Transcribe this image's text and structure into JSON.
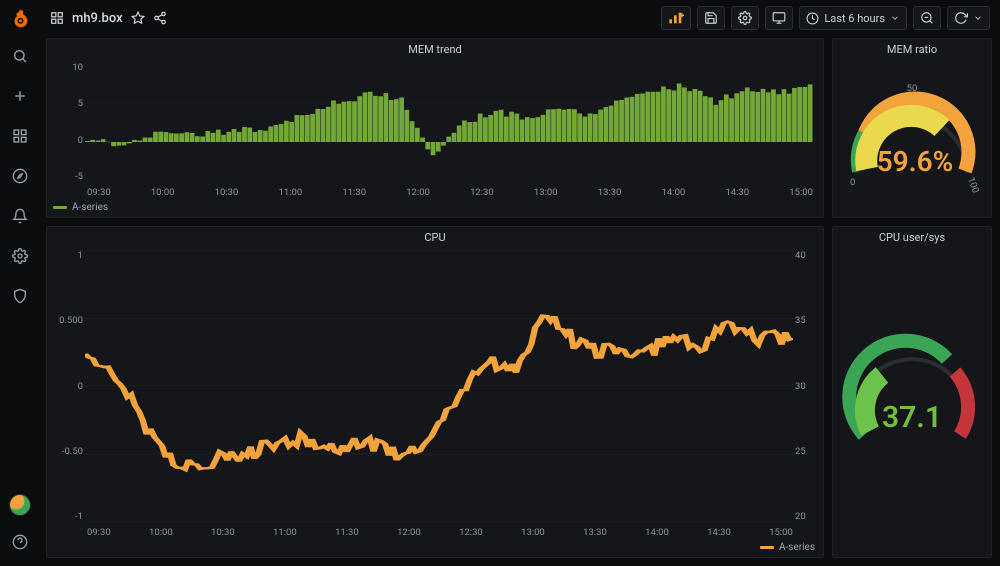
{
  "header": {
    "dashboard_title": "mh9.box",
    "time_range_label": "Last 6 hours"
  },
  "sidebar": {
    "items": [
      {
        "name": "search"
      },
      {
        "name": "create"
      },
      {
        "name": "dashboards"
      },
      {
        "name": "explore"
      },
      {
        "name": "alerting"
      },
      {
        "name": "configuration"
      },
      {
        "name": "server-admin"
      }
    ]
  },
  "panels": {
    "mem_trend": {
      "title": "MEM trend",
      "legend": "A-series",
      "color": "#73a839",
      "y_ticks": [
        "10",
        "5",
        "0",
        "-5"
      ],
      "x_ticks": [
        "09:30",
        "10:00",
        "10:30",
        "11:00",
        "11:30",
        "12:00",
        "12:30",
        "13:00",
        "13:30",
        "14:00",
        "14:30",
        "15:00"
      ]
    },
    "mem_ratio": {
      "title": "MEM ratio",
      "value": "59.6%",
      "scale": {
        "min": "0",
        "mid": "50",
        "max": "100"
      },
      "value_color": "#f2a33c"
    },
    "cpu": {
      "title": "CPU",
      "legend": "A-series",
      "color": "#f2a33c",
      "y_ticks_left": [
        "1",
        "0.500",
        "0",
        "-0.50",
        "-1"
      ],
      "y_ticks_right": [
        "40",
        "35",
        "30",
        "25",
        "20"
      ],
      "x_ticks": [
        "09:30",
        "10:00",
        "10:30",
        "11:00",
        "11:30",
        "12:00",
        "12:30",
        "13:00",
        "13:30",
        "14:00",
        "14:30",
        "15:00"
      ]
    },
    "cpu_user_sys": {
      "title": "CPU user/sys",
      "value": "37.1",
      "value_color": "#73a839"
    }
  },
  "chart_data": [
    {
      "type": "bar",
      "title": "MEM trend",
      "ylabel": "",
      "xlabel": "",
      "ylim": [
        -5,
        10
      ],
      "x": [
        "09:15",
        "09:30",
        "09:45",
        "10:00",
        "10:15",
        "10:30",
        "10:45",
        "11:00",
        "11:15",
        "11:30",
        "11:45",
        "12:00",
        "12:15",
        "12:30",
        "12:45",
        "13:00",
        "13:15",
        "13:30",
        "13:45",
        "14:00",
        "14:15",
        "14:30",
        "14:45",
        "15:00"
      ],
      "series": [
        {
          "name": "A-series",
          "values": [
            0.5,
            -0.3,
            1.0,
            0.8,
            1.2,
            1.5,
            2.0,
            3.5,
            5.0,
            6.0,
            5.5,
            -2.0,
            2.5,
            3.8,
            3.0,
            4.5,
            3.2,
            5.5,
            6.5,
            7.0,
            5.0,
            6.8,
            6.0,
            7.2
          ]
        }
      ]
    },
    {
      "type": "line",
      "title": "CPU",
      "ylabel": "",
      "xlabel": "",
      "ylim": [
        -1,
        1
      ],
      "ylim_right": [
        20,
        40
      ],
      "x": [
        "09:15",
        "09:30",
        "09:45",
        "10:00",
        "10:15",
        "10:30",
        "10:45",
        "11:00",
        "11:15",
        "11:30",
        "11:45",
        "12:00",
        "12:15",
        "12:30",
        "12:45",
        "13:00",
        "13:15",
        "13:30",
        "13:45",
        "14:00",
        "14:15",
        "14:30",
        "14:45",
        "15:00"
      ],
      "series": [
        {
          "name": "A-series",
          "values": [
            0.25,
            0.1,
            -0.3,
            -0.6,
            -0.55,
            -0.5,
            -0.45,
            -0.4,
            -0.45,
            -0.4,
            -0.5,
            -0.45,
            -0.1,
            0.2,
            0.1,
            0.55,
            0.3,
            0.25,
            0.2,
            0.35,
            0.3,
            0.45,
            0.35,
            0.35
          ]
        }
      ]
    }
  ]
}
